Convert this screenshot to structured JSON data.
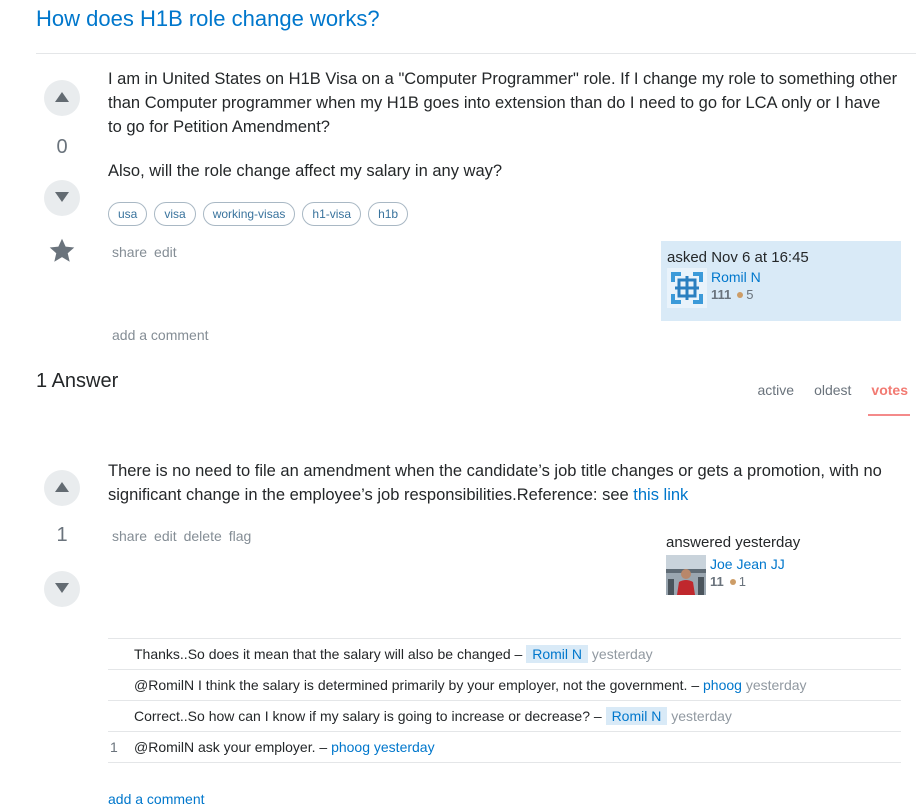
{
  "question": {
    "title": "How does H1B role change works?",
    "score": "0",
    "body_p1": "I am in United States on H1B Visa on a \"Computer Programmer\" role. If I change my role to something other than Computer programmer when my H1B goes into extension than do I need to go for LCA only or I have to go for Petition Amendment?",
    "body_p2": "Also, will the role change affect my salary in any way?",
    "tags": [
      "usa",
      "visa",
      "working-visas",
      "h1-visa",
      "h1b"
    ],
    "menu": {
      "share": "share",
      "edit": "edit"
    },
    "asked": "asked Nov 6 at 16:45",
    "author": {
      "name": "Romil N",
      "rep": "111",
      "bronze": "5"
    },
    "add_comment": "add a comment"
  },
  "answers_header": "1 Answer",
  "sort_tabs": {
    "active": "active",
    "oldest": "oldest",
    "votes": "votes"
  },
  "answer": {
    "score": "1",
    "body": "There is no need to file an amendment when the candidate’s job title changes or gets a promotion, with no significant change in the employee’s job responsibilities.Reference: see ",
    "link": "this link",
    "menu": {
      "share": "share",
      "edit": "edit",
      "delete": "delete",
      "flag": "flag"
    },
    "answered": "answered yesterday",
    "author": {
      "name": "Joe Jean JJ",
      "rep": "11",
      "bronze": "1"
    },
    "comments": [
      {
        "score": "",
        "text": "Thanks..So does it mean that the salary will also be changed – ",
        "user": "Romil N",
        "op": true,
        "date": "yesterday",
        "hot": false
      },
      {
        "score": "",
        "text": "@RomilN I think the salary is determined primarily by your employer, not the government. – ",
        "user": "phoog",
        "op": false,
        "date": "yesterday",
        "hot": false
      },
      {
        "score": "",
        "text": "Correct..So how can I know if my salary is going to increase or decrease? – ",
        "user": "Romil N",
        "op": true,
        "date": "yesterday",
        "hot": false
      },
      {
        "score": "1",
        "text": "@RomilN ask your employer. – ",
        "user": "phoog",
        "op": false,
        "date": "yesterday",
        "hot": true
      }
    ],
    "add_comment": "add a comment"
  },
  "colors": {
    "link": "#0077cc",
    "op_highlight": "#d9eaf7",
    "votes_tab": "#f27a72",
    "bronze": "#cd9d67"
  },
  "icons": [
    "up-arrow-icon",
    "down-arrow-icon",
    "star-icon"
  ]
}
